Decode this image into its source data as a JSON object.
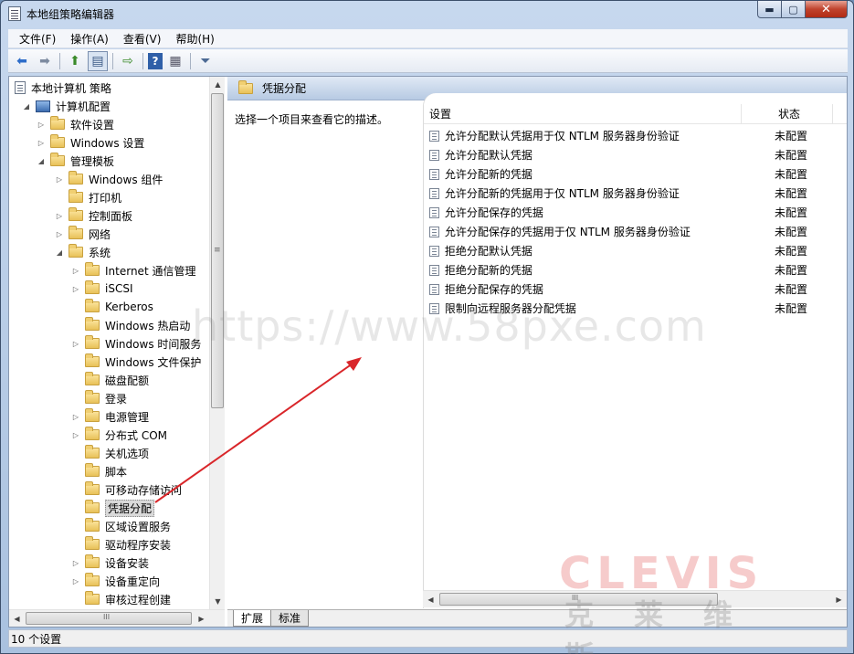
{
  "window": {
    "title": "本地组策略编辑器",
    "minimize": "▬",
    "maximize": "▢",
    "close": "✕"
  },
  "menu": [
    "文件(F)",
    "操作(A)",
    "查看(V)",
    "帮助(H)"
  ],
  "toolbar": {
    "back": "⬅",
    "forward": "➡",
    "up": "⬆",
    "show_hide": "▤",
    "export": "⇨",
    "help": "?",
    "properties": "▦",
    "filter": "⏷"
  },
  "tree": [
    {
      "label": "本地计算机 策略",
      "icon": "policy-document-icon",
      "indent": 0,
      "toggle": ""
    },
    {
      "label": "计算机配置",
      "icon": "computer-icon",
      "indent": 1,
      "toggle": "◢"
    },
    {
      "label": "软件设置",
      "icon": "folder-icon",
      "indent": 2,
      "toggle": "▷"
    },
    {
      "label": "Windows 设置",
      "icon": "folder-icon",
      "indent": 2,
      "toggle": "▷"
    },
    {
      "label": "管理模板",
      "icon": "folder-icon",
      "indent": 2,
      "toggle": "◢"
    },
    {
      "label": "Windows 组件",
      "icon": "folder-icon",
      "indent": 3,
      "toggle": "▷"
    },
    {
      "label": "打印机",
      "icon": "folder-icon",
      "indent": 3,
      "toggle": ""
    },
    {
      "label": "控制面板",
      "icon": "folder-icon",
      "indent": 3,
      "toggle": "▷"
    },
    {
      "label": "网络",
      "icon": "folder-icon",
      "indent": 3,
      "toggle": "▷"
    },
    {
      "label": "系统",
      "icon": "folder-icon",
      "indent": 3,
      "toggle": "◢"
    },
    {
      "label": "Internet 通信管理",
      "icon": "folder-icon",
      "indent": 4,
      "toggle": "▷"
    },
    {
      "label": "iSCSI",
      "icon": "folder-icon",
      "indent": 4,
      "toggle": "▷"
    },
    {
      "label": "Kerberos",
      "icon": "folder-icon",
      "indent": 4,
      "toggle": ""
    },
    {
      "label": "Windows 热启动",
      "icon": "folder-icon",
      "indent": 4,
      "toggle": ""
    },
    {
      "label": "Windows 时间服务",
      "icon": "folder-icon",
      "indent": 4,
      "toggle": "▷"
    },
    {
      "label": "Windows 文件保护",
      "icon": "folder-icon",
      "indent": 4,
      "toggle": ""
    },
    {
      "label": "磁盘配额",
      "icon": "folder-icon",
      "indent": 4,
      "toggle": ""
    },
    {
      "label": "登录",
      "icon": "folder-icon",
      "indent": 4,
      "toggle": ""
    },
    {
      "label": "电源管理",
      "icon": "folder-icon",
      "indent": 4,
      "toggle": "▷"
    },
    {
      "label": "分布式 COM",
      "icon": "folder-icon",
      "indent": 4,
      "toggle": "▷"
    },
    {
      "label": "关机选项",
      "icon": "folder-icon",
      "indent": 4,
      "toggle": ""
    },
    {
      "label": "脚本",
      "icon": "folder-icon",
      "indent": 4,
      "toggle": ""
    },
    {
      "label": "可移动存储访问",
      "icon": "folder-icon",
      "indent": 4,
      "toggle": ""
    },
    {
      "label": "凭据分配",
      "icon": "folder-icon",
      "indent": 4,
      "toggle": "",
      "selected": true
    },
    {
      "label": "区域设置服务",
      "icon": "folder-icon",
      "indent": 4,
      "toggle": ""
    },
    {
      "label": "驱动程序安装",
      "icon": "folder-icon",
      "indent": 4,
      "toggle": ""
    },
    {
      "label": "设备安装",
      "icon": "folder-icon",
      "indent": 4,
      "toggle": "▷"
    },
    {
      "label": "设备重定向",
      "icon": "folder-icon",
      "indent": 4,
      "toggle": "▷"
    },
    {
      "label": "审核过程创建",
      "icon": "folder-icon",
      "indent": 4,
      "toggle": ""
    }
  ],
  "tree_scroll": {
    "grip": "≡",
    "hgrip": "III",
    "up": "▲",
    "down": "▼",
    "left": "◀",
    "right": "▶"
  },
  "right": {
    "header_title": "凭据分配",
    "description": "选择一个项目来查看它的描述。",
    "columns": {
      "setting": "设置",
      "status": "状态"
    },
    "rows": [
      {
        "name": "允许分配默认凭据用于仅 NTLM 服务器身份验证",
        "state": "未配置"
      },
      {
        "name": "允许分配默认凭据",
        "state": "未配置"
      },
      {
        "name": "允许分配新的凭据",
        "state": "未配置"
      },
      {
        "name": "允许分配新的凭据用于仅 NTLM 服务器身份验证",
        "state": "未配置"
      },
      {
        "name": "允许分配保存的凭据",
        "state": "未配置"
      },
      {
        "name": "允许分配保存的凭据用于仅 NTLM 服务器身份验证",
        "state": "未配置"
      },
      {
        "name": "拒绝分配默认凭据",
        "state": "未配置"
      },
      {
        "name": "拒绝分配新的凭据",
        "state": "未配置"
      },
      {
        "name": "拒绝分配保存的凭据",
        "state": "未配置"
      },
      {
        "name": "限制向远程服务器分配凭据",
        "state": "未配置"
      }
    ],
    "hscroll": {
      "left": "◀",
      "right": "▶",
      "grip": "III"
    }
  },
  "tabs": [
    "扩展",
    "标准"
  ],
  "status": "10 个设置",
  "watermark": "https://www.58pxe.com",
  "logo": {
    "big": "CLEVIS",
    "small": "克莱维斯"
  },
  "colors": {
    "annotation_arrow": "#d9262a"
  }
}
